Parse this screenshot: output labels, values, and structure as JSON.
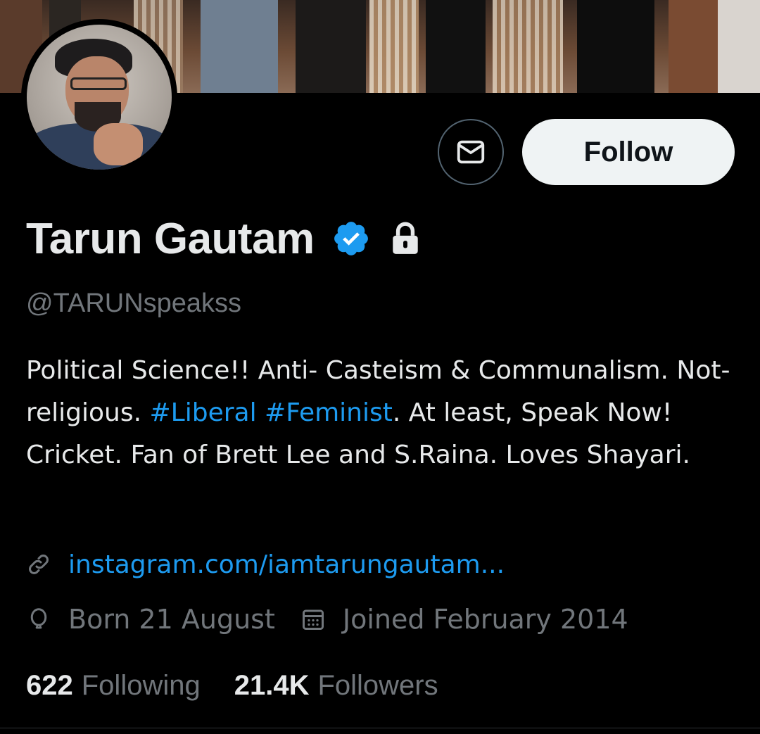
{
  "profile": {
    "name": "Tarun Gautam",
    "handle": "@TARUNspeakss",
    "bio_segments": [
      {
        "text": "Political Science!! Anti- Casteism & Communalism. Not-religious. ",
        "type": "text"
      },
      {
        "text": "#Liberal",
        "type": "hashtag"
      },
      {
        "text": " ",
        "type": "text"
      },
      {
        "text": "#Feminist",
        "type": "hashtag"
      },
      {
        "text": ". At least, Speak Now! Cricket. Fan of Brett Lee and S.Raina.  Loves Shayari.",
        "type": "text"
      }
    ],
    "website": "instagram.com/iamtarungautam...",
    "birthday": "Born 21 August",
    "joined": "Joined February 2014",
    "following_count": "622",
    "following_label": "Following",
    "followers_count": "21.4K",
    "followers_label": "Followers"
  },
  "actions": {
    "follow_label": "Follow"
  },
  "icons": {
    "message": "envelope-icon",
    "verified": "verified-badge-icon",
    "protected": "lock-icon",
    "link": "link-icon",
    "birthday": "balloon-icon",
    "joined": "calendar-icon"
  },
  "colors": {
    "background": "#000000",
    "text_primary": "#e7e9ea",
    "text_secondary": "#71767b",
    "accent": "#1d9bf0",
    "follow_bg": "#eff3f4"
  }
}
